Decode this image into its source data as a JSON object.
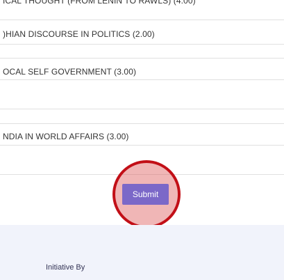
{
  "courses": [
    {
      "label": "ICAL THOUGHT (FROM LENIN TO RAWLS) (4.00)"
    },
    {
      "label": ")HIAN DISCOURSE IN POLITICS (2.00)"
    },
    {
      "label": "OCAL SELF GOVERNMENT (3.00)"
    },
    {
      "label": "NDIA IN WORLD AFFAIRS (3.00)"
    }
  ],
  "form": {
    "submit_label": "Submit"
  },
  "footer": {
    "initiative_label": "Initiative By"
  },
  "colors": {
    "submit_button": "#7b68c8",
    "highlight_ring": "#c20f17",
    "footer_background": "#f1f3fb"
  }
}
